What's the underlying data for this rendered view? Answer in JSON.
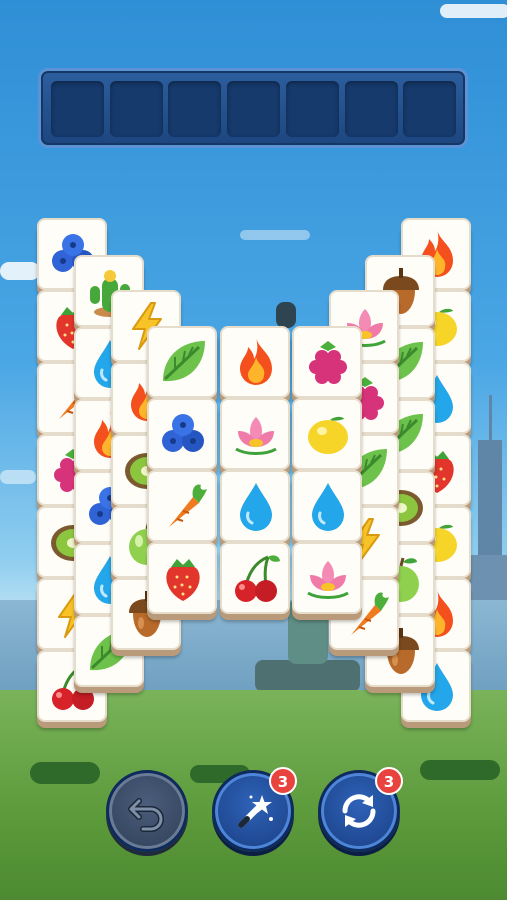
{
  "tray": {
    "slot_count": 7,
    "slots_filled": 0
  },
  "board": {
    "tiles": [
      {
        "icon": "blueberry-icon"
      },
      {
        "icon": "strawberry-icon"
      },
      {
        "icon": "carrot-icon"
      },
      {
        "icon": "raspberry-icon"
      },
      {
        "icon": "kiwi-icon"
      },
      {
        "icon": "lightning-icon"
      },
      {
        "icon": "cherry-icon"
      },
      {
        "icon": "cactus-icon"
      },
      {
        "icon": "water-drop-icon"
      },
      {
        "icon": "fire-icon"
      },
      {
        "icon": "blueberry-icon"
      },
      {
        "icon": "water-drop-icon"
      },
      {
        "icon": "leaf-icon"
      },
      {
        "icon": "lightning-icon"
      },
      {
        "icon": "fire-icon"
      },
      {
        "icon": "kiwi-icon"
      },
      {
        "icon": "apple-icon"
      },
      {
        "icon": "acorn-icon"
      },
      {
        "icon": "fire-icon"
      },
      {
        "icon": "lemon-icon"
      },
      {
        "icon": "water-drop-icon"
      },
      {
        "icon": "strawberry-icon"
      },
      {
        "icon": "lemon-icon"
      },
      {
        "icon": "fire-icon"
      },
      {
        "icon": "water-drop-icon"
      },
      {
        "icon": "acorn-icon"
      },
      {
        "icon": "leaf-icon"
      },
      {
        "icon": "leaf-icon"
      },
      {
        "icon": "kiwi-icon"
      },
      {
        "icon": "apple-icon"
      },
      {
        "icon": "acorn-icon"
      },
      {
        "icon": "lotus-icon"
      },
      {
        "icon": "raspberry-icon"
      },
      {
        "icon": "leaf-icon"
      },
      {
        "icon": "lightning-icon"
      },
      {
        "icon": "carrot-icon"
      },
      {
        "icon": "leaf-icon"
      },
      {
        "icon": "fire-icon"
      },
      {
        "icon": "raspberry-icon"
      },
      {
        "icon": "blueberry-icon"
      },
      {
        "icon": "lotus-icon"
      },
      {
        "icon": "lemon-icon"
      },
      {
        "icon": "carrot-icon"
      },
      {
        "icon": "water-drop-icon"
      },
      {
        "icon": "water-drop-icon"
      },
      {
        "icon": "strawberry-icon"
      },
      {
        "icon": "cherry-icon"
      },
      {
        "icon": "lotus-icon"
      }
    ]
  },
  "controls": {
    "undo": {
      "icon": "undo-icon",
      "enabled": false
    },
    "magic_wand": {
      "icon": "magic-wand-icon",
      "count": "3"
    },
    "shuffle": {
      "icon": "shuffle-icon",
      "count": "3"
    }
  },
  "colors": {
    "tray": "#1d4680",
    "badge": "#e8433f",
    "tile_face": "#fffdf7",
    "tile_edge": "#b99b7b"
  }
}
